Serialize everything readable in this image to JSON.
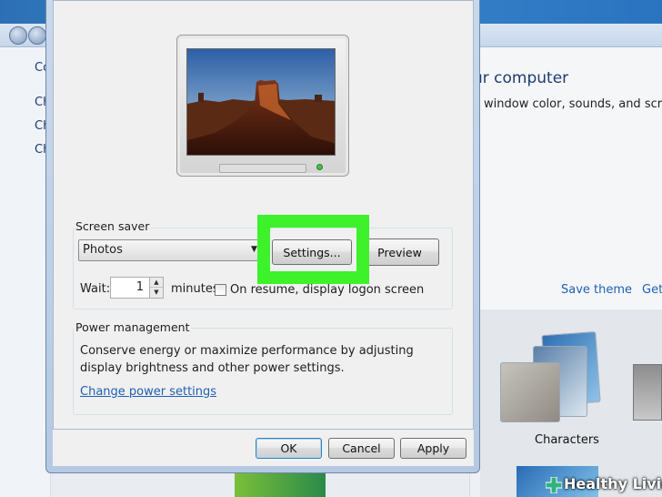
{
  "background": {
    "heading": "ur computer",
    "subtitle": "window color, sounds, and screen s",
    "left_items": [
      "Co",
      "Ch",
      "Ch",
      "Ch"
    ],
    "save_theme_link": "Save theme",
    "get_link": "Get",
    "theme_label": "Characters"
  },
  "dialog": {
    "screen_saver": {
      "group_title": "Screen saver",
      "selected": "Photos",
      "settings_label": "Settings...",
      "preview_label": "Preview",
      "wait_label": "Wait:",
      "wait_value": "1",
      "minutes_label": "minutes",
      "resume_label": "On resume, display logon screen",
      "resume_checked": false
    },
    "power": {
      "group_title": "Power management",
      "description_line1": "Conserve energy or maximize performance by adjusting",
      "description_line2": "display brightness and other power settings.",
      "link": "Change power settings"
    },
    "buttons": {
      "ok": "OK",
      "cancel": "Cancel",
      "apply": "Apply"
    }
  },
  "colors": {
    "highlight": "#3df12b",
    "link": "#1f5fb4"
  },
  "watermark": {
    "text": "Healthy Living"
  }
}
